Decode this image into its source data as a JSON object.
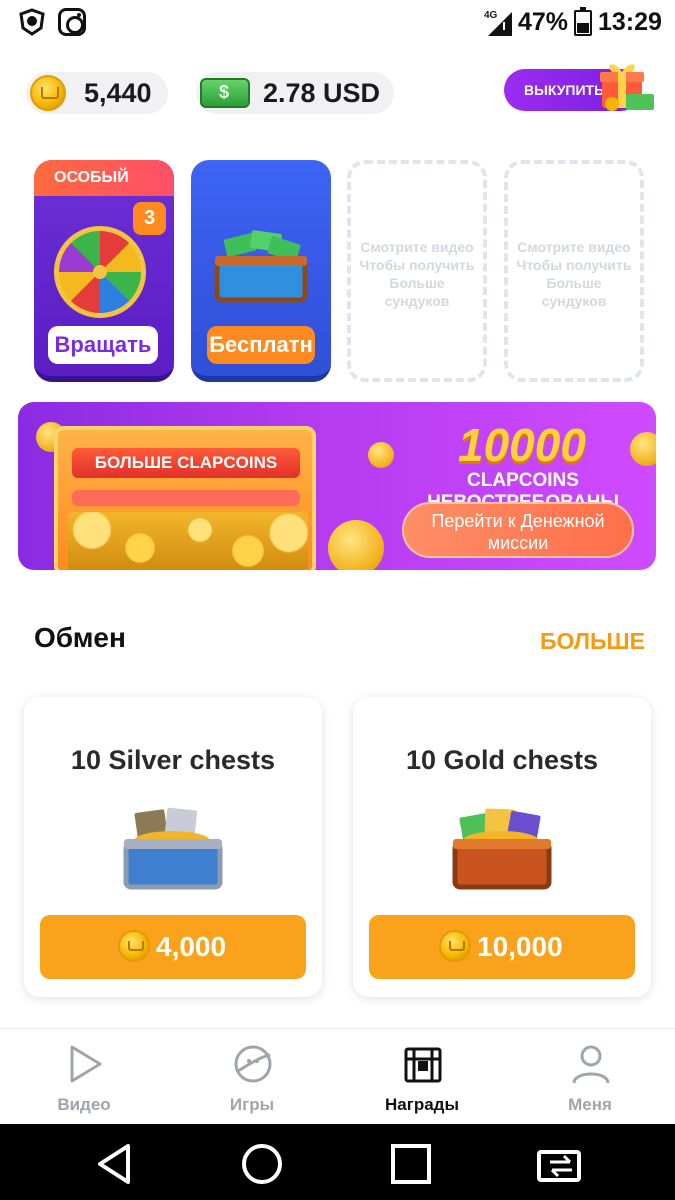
{
  "status_bar": {
    "network": "4G",
    "battery": "47%",
    "time": "13:29"
  },
  "balances": {
    "coins": "5,440",
    "cash": "2.78 USD"
  },
  "redeem_button": {
    "label": "ВЫКУПИТЬ"
  },
  "chest_slots": {
    "spin": {
      "tag": "ОСОБЫЙ",
      "count": "3",
      "button": "Вращать"
    },
    "free": {
      "button": "Бесплатн"
    },
    "empty": {
      "text": "Смотрите видео Чтобы получить Больше сундуков"
    }
  },
  "banner": {
    "box_label": "БОЛЬШЕ CLAPCOINS",
    "amount": "10000",
    "subtitle": "CLAPCOINS НЕВОСТРЕБОВАНЫ",
    "cta": "Перейти к Денежной миссии"
  },
  "exchange": {
    "title": "Обмен",
    "more": "БОЛЬШЕ",
    "items": [
      {
        "title": "10 Silver chests",
        "price": "4,000"
      },
      {
        "title": "10 Gold chests",
        "price": "10,000"
      }
    ]
  },
  "bottom_nav": [
    {
      "label": "Видео",
      "icon": "play-icon",
      "active": false
    },
    {
      "label": "Игры",
      "icon": "planet-icon",
      "active": false
    },
    {
      "label": "Награды",
      "icon": "treasure-chest-icon",
      "active": true
    },
    {
      "label": "Меня",
      "icon": "person-icon",
      "active": false
    }
  ],
  "colors": {
    "accent_orange": "#fba21c",
    "accent_purple": "#8a2be2",
    "more_link": "#f59a12"
  }
}
